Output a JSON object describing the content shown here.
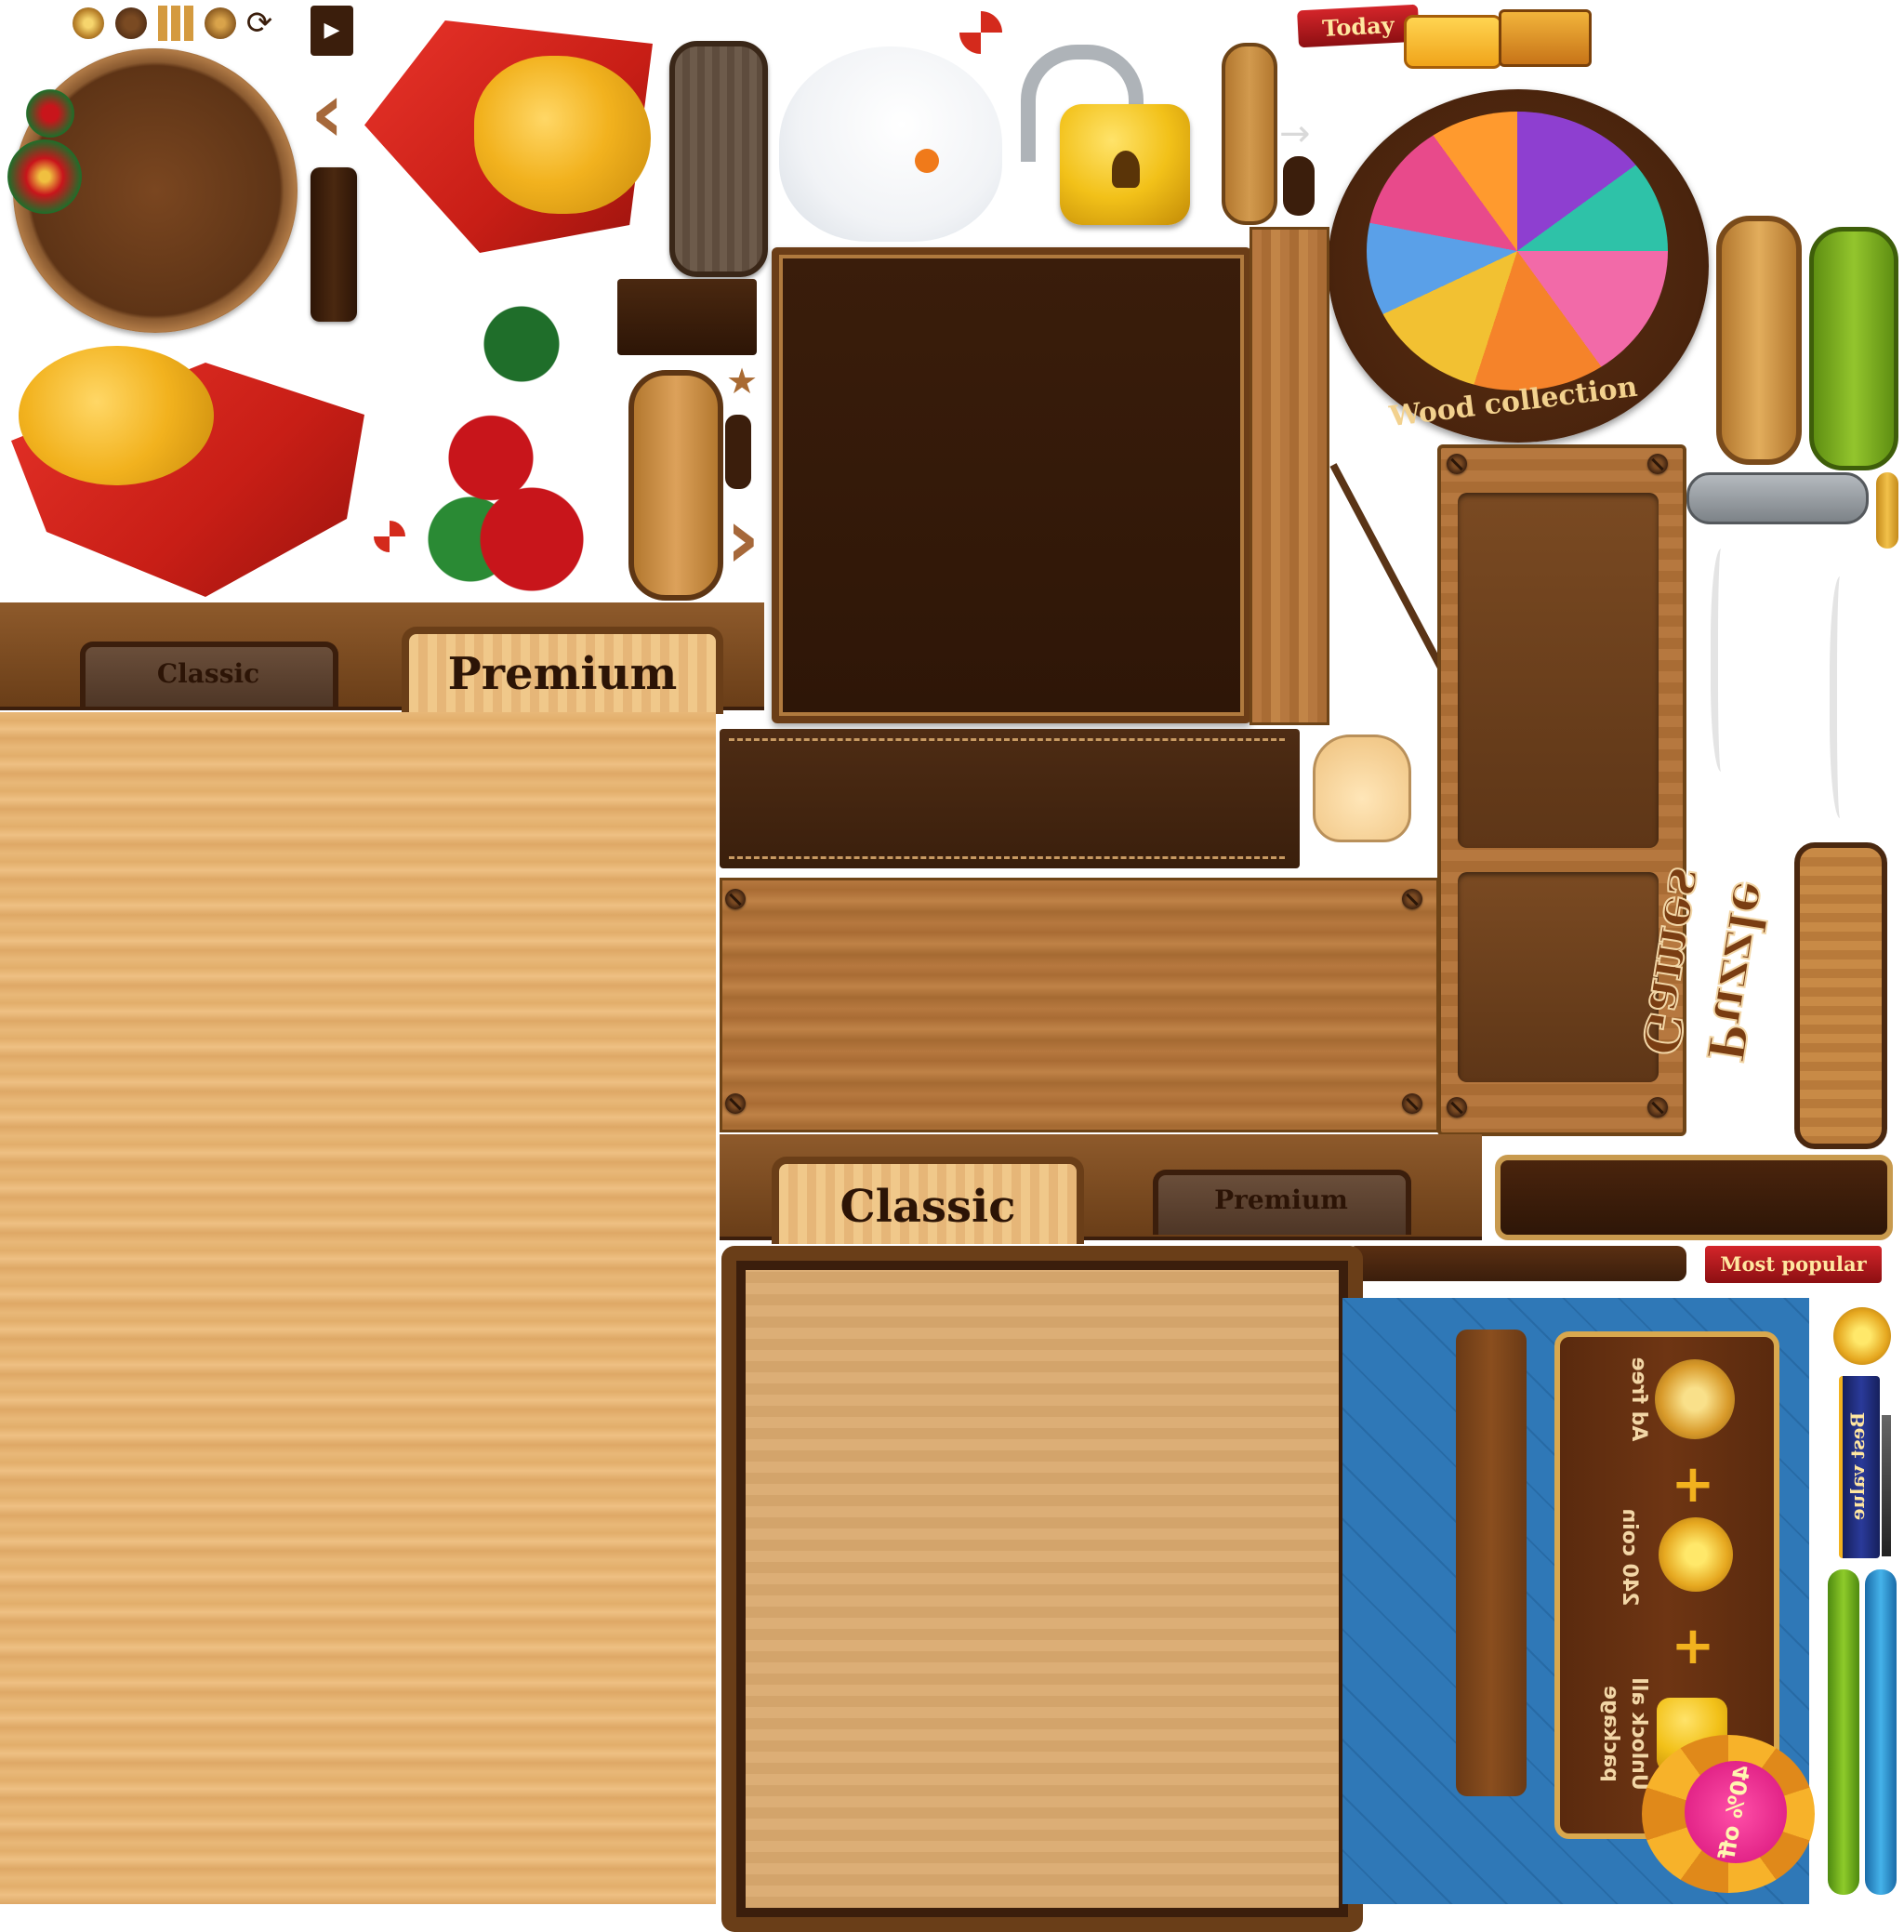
{
  "atlas": {
    "tabs_top": {
      "classic_label": "Classic",
      "premium_label": "Premium"
    },
    "tabs_bottom": {
      "classic_label": "Classic",
      "premium_label": "Premium"
    },
    "badges": {
      "today": "Today",
      "most_popular": "Most popular",
      "best_value": "Best value",
      "wood_collection": "Wood collection",
      "puzzle_games": "Puzzle Games"
    },
    "offer_panel": {
      "ad_free": "Ad free",
      "coins": "240 coin",
      "unlock": "Unlock all",
      "package": "package",
      "plus": "+",
      "discount": "40% off"
    },
    "colors": {
      "wood_dark": "#3b1e0c",
      "wood_light": "#e8b878",
      "gift_red": "#d42a1c",
      "gift_gold": "#f2b21e",
      "quilt_blue": "#2f78b7",
      "green": "#7dbb1f",
      "ribbon_red": "#c8102e",
      "ribbon_blue": "#1f2e7a"
    },
    "icons": [
      "coin-icon",
      "menu-grid-icon",
      "refresh-icon",
      "video-icon",
      "padlock-icon",
      "chest-icon",
      "star-icon",
      "hand-pointer-icon",
      "arrow-left-icon",
      "arrow-right-icon",
      "snowman-icon",
      "gift-icon",
      "poinsettia-icon"
    ]
  }
}
